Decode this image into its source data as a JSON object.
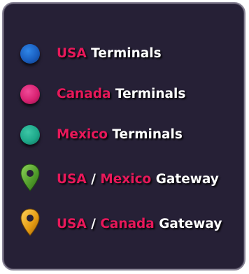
{
  "colors": {
    "panel_bg": "#262036",
    "accent": "#e8185a",
    "text": "#ffffff"
  },
  "legend": {
    "items": [
      {
        "icon": "blue-circle-icon",
        "color": "#1a66c8",
        "parts": [
          "USA",
          "Terminals"
        ]
      },
      {
        "icon": "pink-circle-icon",
        "color": "#e0287a",
        "parts": [
          "Canada",
          "Terminals"
        ]
      },
      {
        "icon": "teal-circle-icon",
        "color": "#1ea88a",
        "parts": [
          "Mexico",
          "Terminals"
        ]
      },
      {
        "icon": "green-map-pin-icon",
        "color": "#57a832",
        "parts": [
          "USA",
          "/",
          "Mexico",
          "Gateway"
        ]
      },
      {
        "icon": "orange-map-pin-icon",
        "color": "#e3a012",
        "parts": [
          "USA",
          "/",
          "Canada",
          "Gateway"
        ]
      }
    ]
  }
}
